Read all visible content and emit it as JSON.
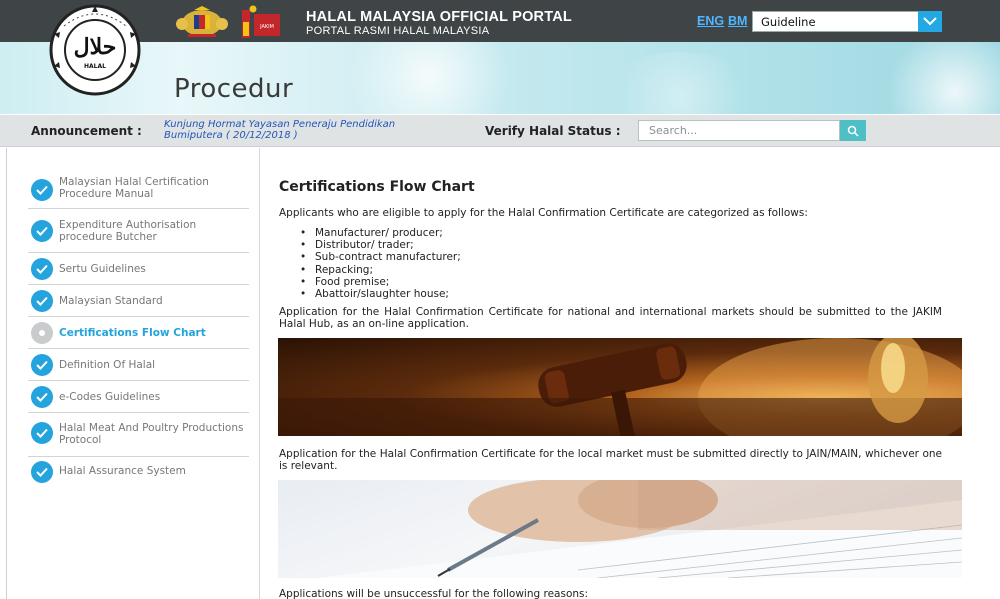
{
  "header": {
    "title": "HALAL MALAYSIA OFFICIAL PORTAL",
    "subtitle": "PORTAL RASMI HALAL MALAYSIA",
    "lang_eng": "ENG",
    "lang_bm": "BM",
    "guide_select_value": "Guideline",
    "halal_logo_text": "HALAL",
    "jakim_text": "JAKIM"
  },
  "banner": {
    "heading": "Procedur"
  },
  "announcement": {
    "label": "Announcement :",
    "text": "Kunjung Hormat Yayasan Peneraju Pendidikan Bumiputera ( 20/12/2018 )",
    "verify_label": "Verify Halal Status :",
    "search_placeholder": "Search..."
  },
  "sidebar": {
    "items": [
      {
        "label": "Malaysian Halal Certification Procedure Manual",
        "active": false
      },
      {
        "label": "Expenditure Authorisation procedure Butcher",
        "active": false
      },
      {
        "label": "Sertu Guidelines",
        "active": false
      },
      {
        "label": "Malaysian Standard",
        "active": false
      },
      {
        "label": "Certifications Flow Chart",
        "active": true
      },
      {
        "label": "Definition Of Halal",
        "active": false
      },
      {
        "label": "e-Codes Guidelines",
        "active": false
      },
      {
        "label": "Halal Meat And Poultry Productions Protocol",
        "active": false
      },
      {
        "label": "Halal Assurance System",
        "active": false
      }
    ]
  },
  "main": {
    "title": "Certifications Flow Chart",
    "intro": "Applicants who are eligible to apply for the Halal Confirmation Certificate are categorized as follows:",
    "bullets": [
      "Manufacturer/ producer;",
      "Distributor/ trader;",
      "Sub-contract manufacturer;",
      "Repacking;",
      "Food premise;",
      "Abattoir/slaughter house;"
    ],
    "para_international": "Application for the Halal Confirmation Certificate for national and international markets should be submitted to the JAKIM Halal Hub, as an on-line application.",
    "para_local": "Application for the Halal Confirmation Certificate for the local market must be submitted directly to JAIN/MAIN, whichever one is relevant.",
    "para_unsuccessful": "Applications will be unsuccessful for the following reasons:"
  },
  "colors": {
    "topbar": "#3f4547",
    "accent_blue": "#24a3dd",
    "link_blue": "#4fb7ff",
    "announcement_text": "#2256b8",
    "search_button": "#4fbfc6"
  }
}
